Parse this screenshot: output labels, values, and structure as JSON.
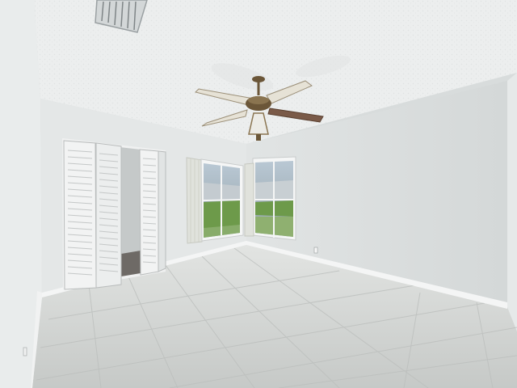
{
  "scene": {
    "description_free": true,
    "colors": {
      "ceiling": "#eceeee",
      "wall_back": "#e3e6e6",
      "wall_right": "#dcdfe0",
      "wall_left": "#e7eaea",
      "floor": "#cfd2d0",
      "grout": "#bfc2c0",
      "baseboard": "#f4f5f5",
      "door_white": "#f2f3f3",
      "closet_interior": "#c9cdcd",
      "window_frame": "#f5f6f6",
      "window_glass": "#9db3c4",
      "greenery": "#6d9a4a",
      "curtain": "#e0e2dc",
      "fan_bronze": "#6b5638",
      "fan_blade_light": "#e6e2d6",
      "fan_blade_dark": "#7a5a48",
      "vent": "#d3d7d8"
    },
    "objects": [
      "ceiling-fan",
      "ceiling-vent",
      "bifold-closet-door-left",
      "bifold-closet-door-right",
      "window-left",
      "window-right",
      "vertical-curtain",
      "tile-floor",
      "baseboard",
      "outlet"
    ]
  }
}
